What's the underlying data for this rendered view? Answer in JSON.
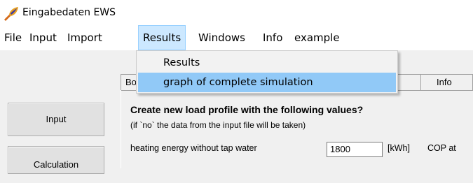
{
  "window": {
    "title": "Eingabedaten EWS",
    "icon": "app-icon"
  },
  "menubar": {
    "items": [
      "File",
      "Input",
      "Import",
      "Results",
      "Windows",
      "Info",
      "example"
    ],
    "active_index": 3
  },
  "results_menu": {
    "items": [
      "Results",
      "graph of complete simulation"
    ],
    "highlighted_index": 1
  },
  "tabs": [
    "Bo",
    "",
    "Info"
  ],
  "sidebar": {
    "buttons": [
      "Input",
      "Calculation"
    ]
  },
  "panel": {
    "heading": "Create new load profile with the following values?",
    "subheading": "(if `no` the data from the input file will be taken)",
    "heating_label": "heating energy without tap water",
    "heating_value": "1800",
    "heating_unit": "[kWh]",
    "cop_label": "COP at"
  },
  "colors": {
    "menu_active_bg": "#cce8ff",
    "menu_highlight_bg": "#91c9f7",
    "window_bg": "#f0f0f0"
  }
}
